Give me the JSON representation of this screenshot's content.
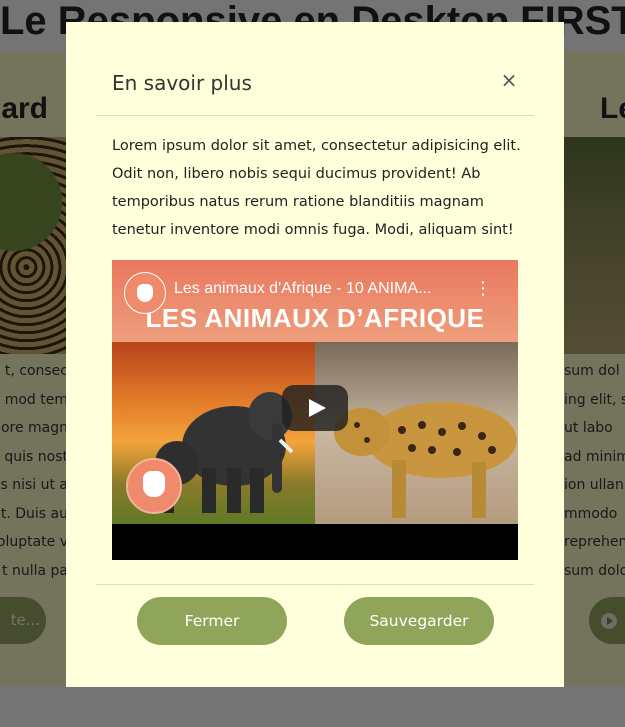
{
  "background": {
    "page_title": "Le Responsive en Desktop FIRST",
    "card_left_heading": "ard",
    "card_right_heading": "Le",
    "card_left_text": [
      "t, consec",
      "mod tem",
      "ore magn",
      "quis nost",
      "s nisi ut a",
      "t. Duis au",
      "oluptate v",
      "t nulla pa"
    ],
    "card_right_text": [
      "sum dol",
      "ing elit, se",
      "ut labo",
      "ad minim",
      "ion ullan",
      "mmodo",
      "reprehen",
      "sum dolor"
    ],
    "card_left_button": "te..."
  },
  "modal": {
    "title": "En savoir plus",
    "close_symbol": "×",
    "body_text": "Lorem ipsum dolor sit amet, consectetur adipisicing elit. Odit non, libero nobis sequi ducimus provident! Ab temporibus natus rerum ratione blanditiis magnam tenetur inventore modi omnis fuga. Modi, aliquam sint!",
    "video": {
      "title": "Les animaux d'Afrique - 10 ANIMA...",
      "thumbnail_heading": "LES ANIMAUX D’AFRIQUE",
      "menu_symbol": "⋮"
    },
    "buttons": {
      "close_label": "Fermer",
      "save_label": "Sauvegarder"
    }
  },
  "colors": {
    "modal_bg": "#ffffdb",
    "button_bg": "#8fa55a",
    "overlay": "rgba(0,0,0,0.5)"
  }
}
